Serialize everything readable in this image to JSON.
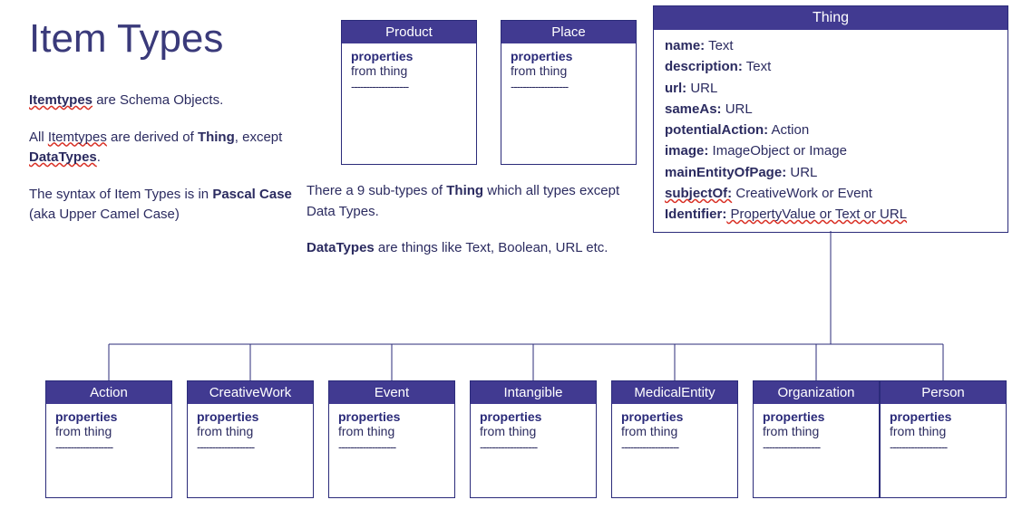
{
  "title": "Item Types",
  "intro": {
    "p1_a": "Itemtypes",
    "p1_b": " are Schema Objects.",
    "p2_a": "All ",
    "p2_b": "Itemtypes",
    "p2_c": " are derived of ",
    "p2_d": "Thing",
    "p2_e": ", except ",
    "p2_f": "DataTypes",
    "p2_g": ".",
    "p3_a": "The syntax of Item Types is in ",
    "p3_b": "Pascal Case",
    "p3_c": " (aka Upper Camel Case)"
  },
  "mid": {
    "p1_a": "There a 9 sub-types of ",
    "p1_b": "Thing",
    "p1_c": " which all types except Data Types.",
    "p2_a": "DataTypes",
    "p2_b": " are things like Text, Boolean, URL etc."
  },
  "thing": {
    "title": "Thing",
    "rows": [
      {
        "k": "name:",
        "v": " Text"
      },
      {
        "k": "description:",
        "v": " Text"
      },
      {
        "k": "url:",
        "v": " URL"
      },
      {
        "k": "sameAs:",
        "v": " URL"
      },
      {
        "k": "potentialAction:",
        "v": " Action"
      },
      {
        "k": "image:",
        "v": " ImageObject or Image"
      },
      {
        "k": "mainEntityOfPage:",
        "v": " URL"
      },
      {
        "k": "subjectOf:",
        "v": " CreativeWork or Event",
        "spellk": true
      },
      {
        "k": "Identifier:",
        "v": " PropertyValue or Text or URL",
        "spellv": true
      }
    ]
  },
  "smallBoxes": [
    {
      "title": "Product",
      "prop": "properties",
      "from": "from thing",
      "dash": "-------------------"
    },
    {
      "title": "Place",
      "prop": "properties",
      "from": "from thing",
      "dash": "-------------------"
    }
  ],
  "bottomBoxes": [
    {
      "title": "Action",
      "prop": "properties",
      "from": "from thing",
      "dash": "-------------------"
    },
    {
      "title": "CreativeWork",
      "prop": "properties",
      "from": "from thing",
      "dash": "-------------------"
    },
    {
      "title": "Event",
      "prop": "properties",
      "from": "from thing",
      "dash": "-------------------"
    },
    {
      "title": "Intangible",
      "prop": "properties",
      "from": "from thing",
      "dash": "-------------------"
    },
    {
      "title": "MedicalEntity",
      "prop": "properties",
      "from": "from thing",
      "dash": "-------------------"
    },
    {
      "title": "Organization",
      "prop": "properties",
      "from": "from thing",
      "dash": "-------------------"
    },
    {
      "title": "Person",
      "prop": "properties",
      "from": "from thing",
      "dash": "-------------------"
    }
  ]
}
